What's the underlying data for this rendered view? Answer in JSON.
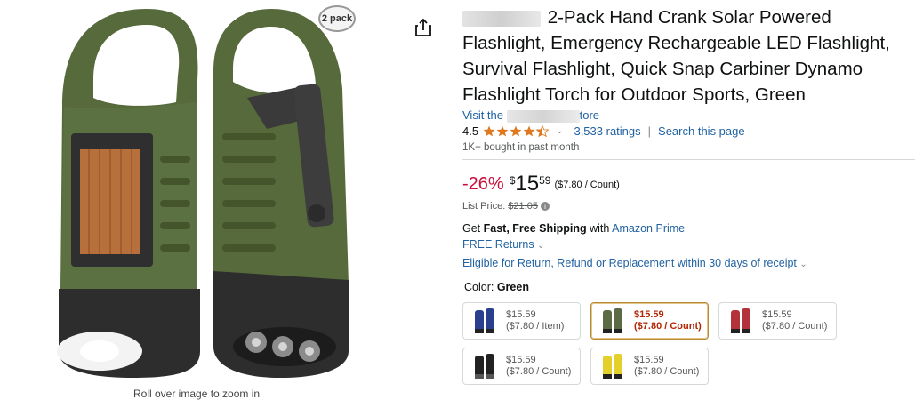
{
  "image": {
    "badge": "2 pack",
    "caption": "Roll over image to zoom in"
  },
  "product": {
    "title": "2-Pack Hand Crank Solar Powered Flashlight, Emergency Rechargeable LED Flashlight, Survival Flashlight, Quick Snap Carbiner Dynamo Flashlight Torch for Outdoor Sports, Green",
    "store_prefix": "Visit the",
    "store_suffix": "tore",
    "rating_value": "4.5",
    "rating_count": "3,533 ratings",
    "search_page": "Search this page",
    "bought": "1K+ bought in past month"
  },
  "price": {
    "discount": "-26%",
    "symbol": "$",
    "whole": "15",
    "fraction": "59",
    "per_unit": "($7.80 / Count)",
    "list_label": "List Price:",
    "list_value": "$21.05"
  },
  "shipping": {
    "get": "Get",
    "fast": "Fast, Free Shipping",
    "with": "with",
    "prime": "Amazon Prime",
    "returns": "FREE Returns",
    "eligible": "Eligible for Return, Refund or Replacement within 30 days of receipt"
  },
  "color": {
    "label": "Color:",
    "selected": "Green",
    "options": [
      {
        "price": "$15.59",
        "unit": "($7.80 / Item)",
        "color": "#2b3f8f"
      },
      {
        "price": "$15.59",
        "unit": "($7.80 / Count)",
        "color": "#5b6b45"
      },
      {
        "price": "$15.59",
        "unit": "($7.80 / Count)",
        "color": "#b3333b"
      },
      {
        "price": "$15.59",
        "unit": "($7.80 / Count)",
        "color": "#222222"
      },
      {
        "price": "$15.59",
        "unit": "($7.80 / Count)",
        "color": "#e3d02a"
      }
    ]
  },
  "colors": {
    "link": "#2162a1",
    "discount": "#cc0c39",
    "star": "#de7921",
    "olive": "#4f6232"
  }
}
